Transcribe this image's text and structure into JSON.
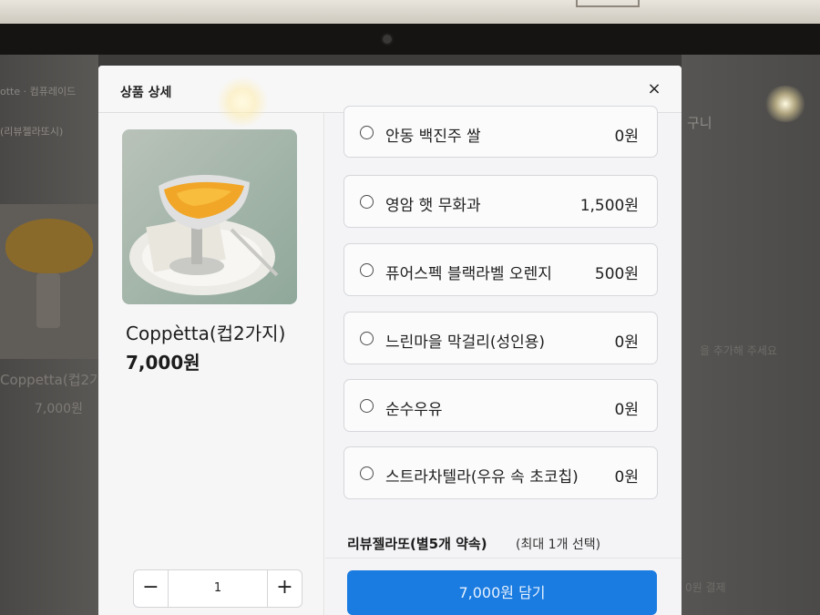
{
  "background": {
    "tab_text": "otte · 컴퓨레이드",
    "category_text": "(리뷰젤라또시)",
    "product_name": "Coppetta(컵2가",
    "product_price": "7,000원",
    "cart_text": "구니",
    "right_hint": "을 추가해 주세요",
    "right_bottom": "0원 결제"
  },
  "modal": {
    "title": "상품 상세",
    "close_label": "×"
  },
  "product": {
    "name": "Coppètta(컵2가지)",
    "price": "7,000원"
  },
  "quantity": {
    "minus_label": "−",
    "value": "1",
    "plus_label": "+"
  },
  "options": [
    {
      "label": "안동 백진주 쌀",
      "price": "0원"
    },
    {
      "label": "영암 햇 무화과",
      "price": "1,500원"
    },
    {
      "label": "퓨어스펙 블랙라벨 오렌지",
      "price": "500원"
    },
    {
      "label": "느린마을 막걸리(성인용)",
      "price": "0원"
    },
    {
      "label": "순수우유",
      "price": "0원"
    },
    {
      "label": "스트라차텔라(우유 속 초코칩)",
      "price": "0원"
    }
  ],
  "next_group": {
    "title": "리뷰젤라또(별5개 약속)",
    "hint": "(최대 1개 선택)"
  },
  "add_button_label": "7,000원 담기",
  "colors": {
    "accent": "#1a7be0",
    "modal_bg": "#f6f6f7",
    "border": "#d6d7db"
  }
}
